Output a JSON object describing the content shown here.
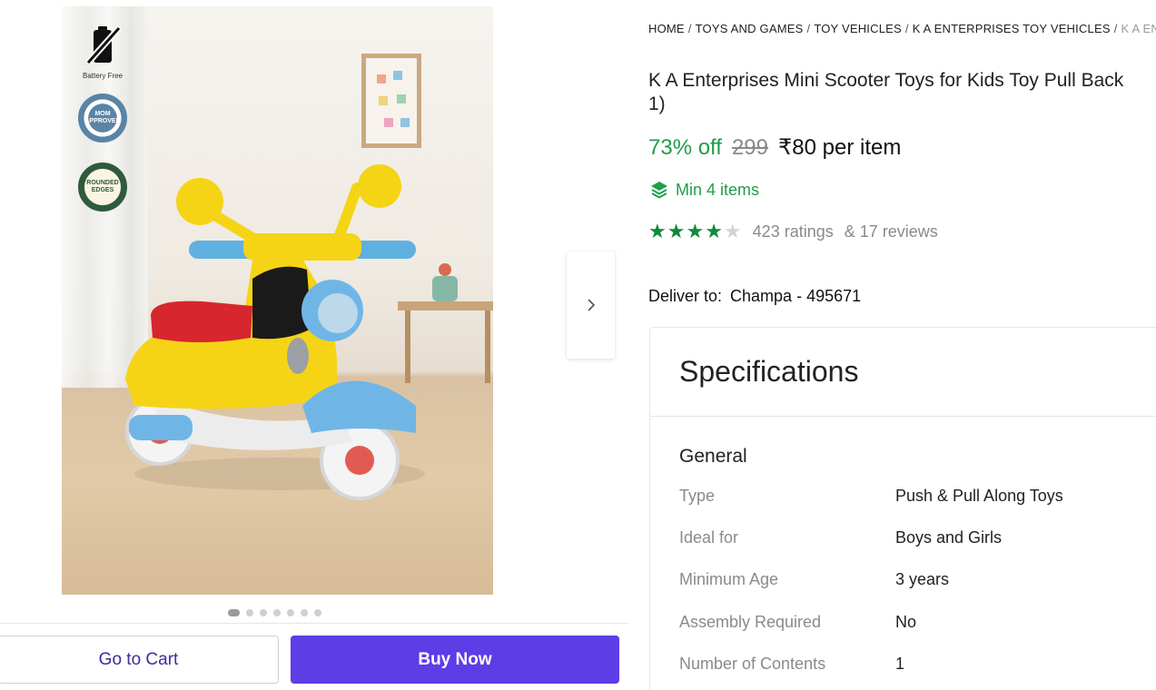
{
  "breadcrumb": {
    "items": [
      "HOME",
      "TOYS AND GAMES",
      "TOY VEHICLES",
      "K A ENTERPRISES TOY VEHICLES"
    ],
    "last": "K A EN"
  },
  "product": {
    "title_line1": "K A Enterprises Mini Scooter Toys for Kids Toy Pull Back",
    "title_line2": "1)",
    "discount": "73% off",
    "mrp": "299",
    "price": "₹80 per item",
    "min_items": "Min 4 items",
    "rating": 4,
    "rating_max": 5,
    "ratings_text": "423 ratings",
    "reviews_text": "& 17 reviews"
  },
  "badges": {
    "battery_free": "Battery Free",
    "mom_approved": "MOM APPROVED",
    "rounded_edges": "ROUNDED EDGES"
  },
  "image_gallery": {
    "count": 7,
    "active_index": 0
  },
  "delivery": {
    "label": "Deliver to:",
    "location": "Champa - 495671"
  },
  "actions": {
    "cart": "Go to Cart",
    "buy": "Buy Now"
  },
  "specifications": {
    "heading": "Specifications",
    "section": "General",
    "rows": [
      {
        "key": "Type",
        "value": "Push & Pull Along Toys"
      },
      {
        "key": "Ideal for",
        "value": "Boys and Girls"
      },
      {
        "key": "Minimum Age",
        "value": "3 years"
      },
      {
        "key": "Assembly Required",
        "value": "No"
      },
      {
        "key": "Number of Contents",
        "value": "1"
      }
    ]
  },
  "colors": {
    "accent": "#5c3de6",
    "discount_green": "#1f9e4a",
    "star_green": "#0f8a3a"
  }
}
